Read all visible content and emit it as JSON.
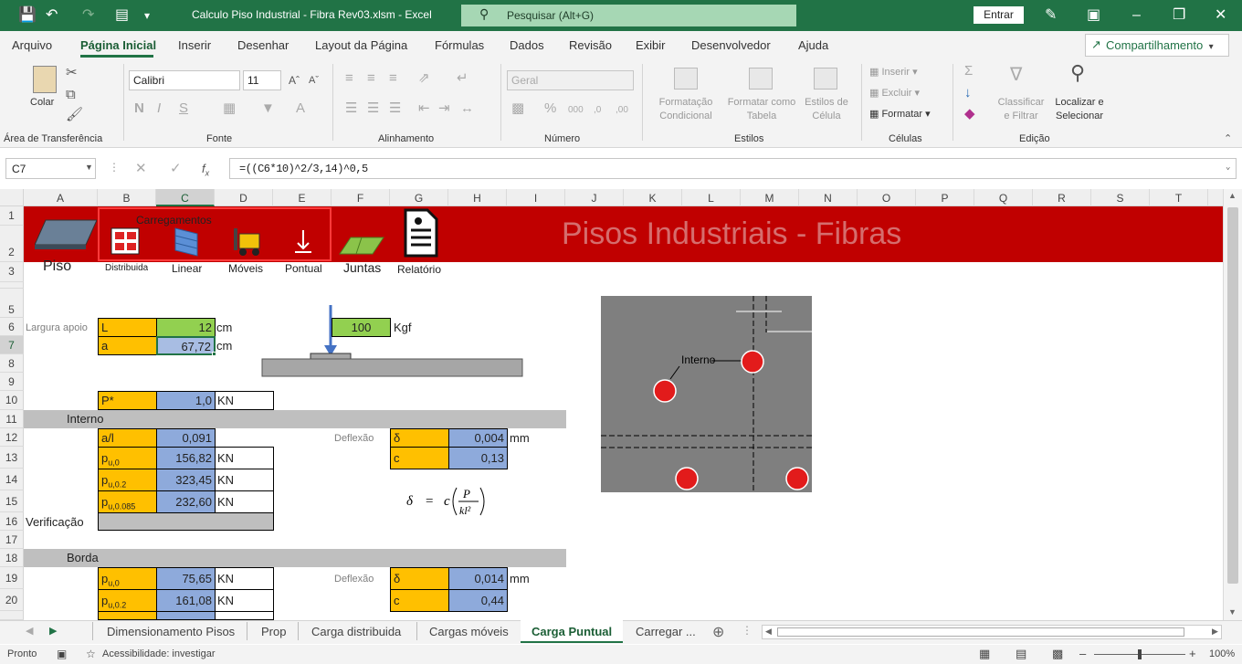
{
  "window": {
    "title": "Calculo Piso Industrial - Fibra Rev03.xlsm  -  Excel",
    "search_placeholder": "Pesquisar (Alt+G)",
    "signin_label": "Entrar"
  },
  "menu": [
    "Arquivo",
    "Página Inicial",
    "Inserir",
    "Desenhar",
    "Layout da Página",
    "Fórmulas",
    "Dados",
    "Revisão",
    "Exibir",
    "Desenvolvedor",
    "Ajuda"
  ],
  "share_label": "Compartilhamento",
  "ribbon": {
    "paste_label": "Colar",
    "clipboard_group": "Área de Transferência",
    "font_name": "Calibri",
    "font_size": "11",
    "font_group": "Fonte",
    "alignment_group": "Alinhamento",
    "number_format": "Geral",
    "number_group": "Número",
    "cond_format": [
      "Formatação",
      "Condicional"
    ],
    "format_table": [
      "Formatar como",
      "Tabela"
    ],
    "cell_styles": [
      "Estilos de",
      "Célula"
    ],
    "styles_group": "Estilos",
    "insert_label": "Inserir",
    "delete_label": "Excluir",
    "format_label": "Formatar",
    "cells_group": "Células",
    "sort_filter": [
      "Classificar",
      "e Filtrar"
    ],
    "find_select": [
      "Localizar e",
      "Selecionar"
    ],
    "editing_group": "Edição"
  },
  "formula_bar": {
    "name_box": "C7",
    "formula": "=((C6*10)^2/3,14)^0,5"
  },
  "columns": [
    "A",
    "B",
    "C",
    "D",
    "E",
    "F",
    "G",
    "H",
    "I",
    "J",
    "K",
    "L",
    "M",
    "N",
    "O",
    "P",
    "Q",
    "R",
    "S",
    "T"
  ],
  "rows": [
    "1",
    "2",
    "3",
    "5",
    "6",
    "7",
    "8",
    "9",
    "10",
    "11",
    "12",
    "13",
    "14",
    "15",
    "16",
    "17",
    "18",
    "19",
    "20"
  ],
  "banner": {
    "title": "Pisos Industriais - Fibras",
    "carregamentos": "Carregamentos",
    "piso": "Piso",
    "distribuida": "Distribuida",
    "linear": "Linear",
    "moveis": "Móveis",
    "pontual": "Pontual",
    "juntas": "Juntas",
    "relatorio": "Relatório"
  },
  "sheet": {
    "largura_apoio": "Largura apoio",
    "L_label": "L",
    "L_value": "12",
    "L_unit": "cm",
    "a_label": "a",
    "a_value": "67,72",
    "a_unit": "cm",
    "load_value": "100",
    "load_unit": "Kgf",
    "p_label": "P*",
    "p_value": "1,0",
    "p_unit": "KN",
    "interno": "Interno",
    "al_label": "a/l",
    "al_value": "0,091",
    "pu0_value": "156,82",
    "pu02_value": "323,45",
    "pu0085_value": "232,60",
    "kn": "KN",
    "deflexao": "Deflexão",
    "delta_label": "δ",
    "c_label": "c",
    "int_delta": "0,004",
    "int_c": "0,13",
    "mm": "mm",
    "verificacao": "Verificação",
    "borda": "Borda",
    "b_pu0_value": "75,65",
    "b_pu02_value": "161,08",
    "b_delta": "0,014",
    "b_c": "0,44",
    "interno_diagram": "Interno"
  },
  "sheet_tabs": [
    "Dimensionamento Pisos",
    "Prop",
    "Carga distribuida",
    "Cargas móveis",
    "Carga Puntual",
    "Carregar ..."
  ],
  "status": {
    "ready": "Pronto",
    "accessibility": "Acessibilidade: investigar",
    "zoom": "100%"
  }
}
